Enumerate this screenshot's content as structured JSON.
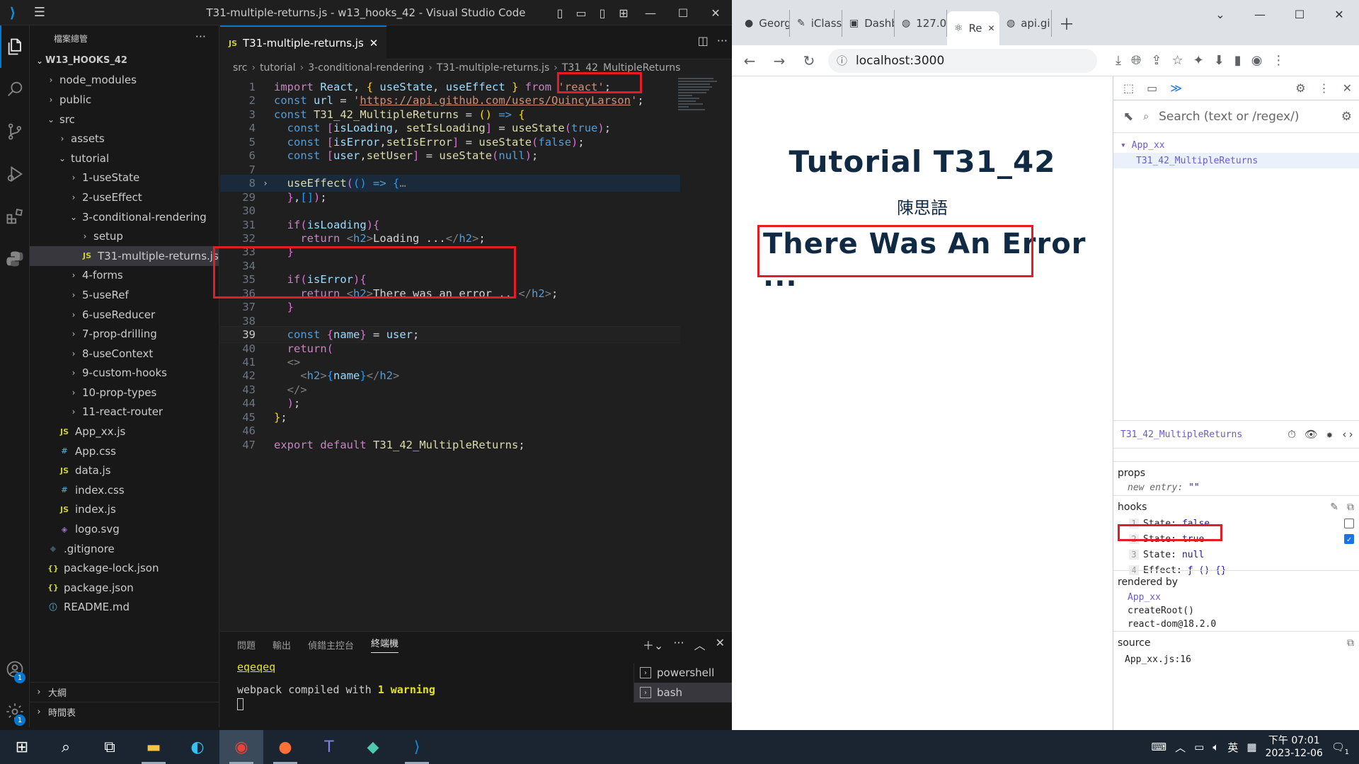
{
  "vscode": {
    "window_title": "T31-multiple-returns.js - w13_hooks_42 - Visual Studio Code",
    "explorer_header": "檔案總管",
    "root": "W13_HOOKS_42",
    "tree": [
      {
        "label": "node_modules",
        "depth": 1,
        "type": "folder",
        "open": false
      },
      {
        "label": "public",
        "depth": 1,
        "type": "folder",
        "open": false
      },
      {
        "label": "src",
        "depth": 1,
        "type": "folder",
        "open": true
      },
      {
        "label": "assets",
        "depth": 2,
        "type": "folder",
        "open": false
      },
      {
        "label": "tutorial",
        "depth": 2,
        "type": "folder",
        "open": true
      },
      {
        "label": "1-useState",
        "depth": 3,
        "type": "folder",
        "open": false
      },
      {
        "label": "2-useEffect",
        "depth": 3,
        "type": "folder",
        "open": false
      },
      {
        "label": "3-conditional-rendering",
        "depth": 3,
        "type": "folder",
        "open": true
      },
      {
        "label": "setup",
        "depth": 4,
        "type": "folder",
        "open": false
      },
      {
        "label": "T31-multiple-returns.js",
        "depth": 4,
        "type": "js",
        "selected": true
      },
      {
        "label": "4-forms",
        "depth": 3,
        "type": "folder",
        "open": false
      },
      {
        "label": "5-useRef",
        "depth": 3,
        "type": "folder",
        "open": false
      },
      {
        "label": "6-useReducer",
        "depth": 3,
        "type": "folder",
        "open": false
      },
      {
        "label": "7-prop-drilling",
        "depth": 3,
        "type": "folder",
        "open": false
      },
      {
        "label": "8-useContext",
        "depth": 3,
        "type": "folder",
        "open": false
      },
      {
        "label": "9-custom-hooks",
        "depth": 3,
        "type": "folder",
        "open": false
      },
      {
        "label": "10-prop-types",
        "depth": 3,
        "type": "folder",
        "open": false
      },
      {
        "label": "11-react-router",
        "depth": 3,
        "type": "folder",
        "open": false
      },
      {
        "label": "App_xx.js",
        "depth": 2,
        "type": "js"
      },
      {
        "label": "App.css",
        "depth": 2,
        "type": "css"
      },
      {
        "label": "data.js",
        "depth": 2,
        "type": "js"
      },
      {
        "label": "index.css",
        "depth": 2,
        "type": "css"
      },
      {
        "label": "index.js",
        "depth": 2,
        "type": "js"
      },
      {
        "label": "logo.svg",
        "depth": 2,
        "type": "svg"
      },
      {
        "label": ".gitignore",
        "depth": 1,
        "type": "git"
      },
      {
        "label": "package-lock.json",
        "depth": 1,
        "type": "json"
      },
      {
        "label": "package.json",
        "depth": 1,
        "type": "json"
      },
      {
        "label": "README.md",
        "depth": 1,
        "type": "info"
      }
    ],
    "outline_label": "大綱",
    "timeline_label": "時間表",
    "tab_label": "T31-multiple-returns.js",
    "tab_icon": "JS",
    "breadcrumb": [
      "src",
      "tutorial",
      "3-conditional-rendering",
      "T31-multiple-returns.js",
      "T31_42_MultipleReturns"
    ],
    "code_lines": [
      {
        "n": "1",
        "html": "<span class=\"kc\">import</span> <span class=\"v\">React</span>, <span class=\"b1\">{</span> <span class=\"v\">useState</span>, <span class=\"v\">useEffect</span> <span class=\"b1\">}</span> <span class=\"kc\">from</span> <span class=\"s\">'react'</span>;"
      },
      {
        "n": "2",
        "html": "<span class=\"k\">const</span> <span class=\"v\">url</span> = <span class=\"s\">'<u>https://api.github.com/users/QuincyLarson</u>'</span>;"
      },
      {
        "n": "3",
        "html": "<span class=\"k\">const</span> <span class=\"f\">T31_42_MultipleReturns</span> = <span class=\"b1\">()</span> <span class=\"k\">=></span> <span class=\"b1\">{</span>"
      },
      {
        "n": "4",
        "html": "  <span class=\"k\">const</span> <span class=\"b2\">[</span><span class=\"v\">isLoading</span>, <span class=\"f\">setIsLoading</span><span class=\"b2\">]</span> = <span class=\"f\">useState</span><span class=\"b2\">(</span><span class=\"k\">true</span><span class=\"b2\">)</span>;"
      },
      {
        "n": "5",
        "html": "  <span class=\"k\">const</span> <span class=\"b2\">[</span><span class=\"v\">isError</span>,<span class=\"f\">setIsError</span><span class=\"b2\">]</span> = <span class=\"f\">useState</span><span class=\"b2\">(</span><span class=\"k\">false</span><span class=\"b2\">)</span>;"
      },
      {
        "n": "6",
        "html": "  <span class=\"k\">const</span> <span class=\"b2\">[</span><span class=\"v\">user</span>,<span class=\"f\">setUser</span><span class=\"b2\">]</span> = <span class=\"f\">useState</span><span class=\"b2\">(</span><span class=\"k\">null</span><span class=\"b2\">)</span>;"
      },
      {
        "n": "7",
        "html": ""
      },
      {
        "n": "8",
        "html": "  <span class=\"f\">useEffect</span><span class=\"b2\">(</span><span class=\"b3\">()</span> <span class=\"k\">=></span> <span class=\"b3\">{</span><span class=\"g\">…</span>",
        "fold": "›",
        "hl": true
      },
      {
        "n": "29",
        "html": "  <span class=\"b2\">}</span>,<span class=\"b3\">[]</span><span class=\"b2\">)</span>;"
      },
      {
        "n": "30",
        "html": ""
      },
      {
        "n": "31",
        "html": "  <span class=\"kc\">if</span><span class=\"b2\">(</span><span class=\"v\">isLoading</span><span class=\"b2\">){</span>"
      },
      {
        "n": "32",
        "html": "    <span class=\"kc\">return</span> <span class=\"g\">&lt;</span><span class=\"tg\">h2</span><span class=\"g\">&gt;</span>Loading ...<span class=\"g\">&lt;/</span><span class=\"tg\">h2</span><span class=\"g\">&gt;</span>;"
      },
      {
        "n": "33",
        "html": "  <span class=\"b2\">}</span>"
      },
      {
        "n": "34",
        "html": ""
      },
      {
        "n": "35",
        "html": "  <span class=\"kc\">if</span><span class=\"b2\">(</span><span class=\"v\">isError</span><span class=\"b2\">){</span>"
      },
      {
        "n": "36",
        "html": "    <span class=\"kc\">return</span> <span class=\"g\">&lt;</span><span class=\"tg\">h2</span><span class=\"g\">&gt;</span>There was an error ...<span class=\"g\">&lt;/</span><span class=\"tg\">h2</span><span class=\"g\">&gt;</span>;"
      },
      {
        "n": "37",
        "html": "  <span class=\"b2\">}</span>"
      },
      {
        "n": "38",
        "html": ""
      },
      {
        "n": "39",
        "html": "  <span class=\"k\">const</span> <span class=\"b2\">{</span><span class=\"v\">name</span><span class=\"b2\">}</span> = <span class=\"v\">user</span>;",
        "cur": true
      },
      {
        "n": "40",
        "html": "  <span class=\"kc\">return</span><span class=\"b2\">(</span>"
      },
      {
        "n": "41",
        "html": "  <span class=\"g\">&lt;&gt;</span>"
      },
      {
        "n": "42",
        "html": "    <span class=\"g\">&lt;</span><span class=\"tg\">h2</span><span class=\"g\">&gt;</span><span class=\"b3\">{</span><span class=\"v\">name</span><span class=\"b3\">}</span><span class=\"g\">&lt;/</span><span class=\"tg\">h2</span><span class=\"g\">&gt;</span>"
      },
      {
        "n": "43",
        "html": "  <span class=\"g\">&lt;/&gt;</span>"
      },
      {
        "n": "44",
        "html": "  <span class=\"b2\">)</span>;"
      },
      {
        "n": "45",
        "html": "<span class=\"b1\">}</span>;"
      },
      {
        "n": "46",
        "html": ""
      },
      {
        "n": "47",
        "html": "<span class=\"kc\">export</span> <span class=\"kc\">default</span> <span class=\"f\">T31_42_MultipleReturns</span>;"
      }
    ],
    "panel_tabs": [
      "問題",
      "輸出",
      "偵錯主控台",
      "終端機"
    ],
    "terminal": {
      "line1": "eqeqeq",
      "line2_prefix": "webpack compiled with ",
      "line2_em": "1 warning"
    },
    "shells": [
      "powershell",
      "bash"
    ],
    "account_badge": "1",
    "settings_badge": "1"
  },
  "chrome": {
    "tabs": [
      {
        "label": "Georg",
        "icon": "github-icon"
      },
      {
        "label": "iClass",
        "icon": "iclass-icon"
      },
      {
        "label": "Dashb",
        "icon": "dashboard-icon"
      },
      {
        "label": "127.0",
        "icon": "globe-icon"
      },
      {
        "label": "Re",
        "icon": "react-icon",
        "active": true
      },
      {
        "label": "api.gi",
        "icon": "globe-icon"
      }
    ],
    "url": "localhost:3000",
    "page": {
      "title": "Tutorial T31_42",
      "subtitle": "陳思語",
      "error": "There Was An Error ..."
    },
    "devtools": {
      "search_placeholder": "Search (text or /regex/)",
      "tree": [
        {
          "label": "▾ App_xx"
        },
        {
          "label": "T31_42_MultipleReturns",
          "selected": true
        }
      ],
      "component": "T31_42_MultipleReturns",
      "props_title": "props",
      "props_new_entry_label": "new entry:",
      "props_new_entry_value": "\"\"",
      "hooks_title": "hooks",
      "hooks": [
        {
          "n": "1",
          "k": "State:",
          "v": "false"
        },
        {
          "n": "2",
          "k": "State:",
          "v": "true"
        },
        {
          "n": "3",
          "k": "State:",
          "v": "null"
        },
        {
          "n": "4",
          "k": "Effect:",
          "v": "ƒ () {}"
        }
      ],
      "rendered_by_title": "rendered by",
      "rendered_by": [
        "App_xx",
        "createRoot()",
        "react-dom@18.2.0"
      ],
      "source_title": "source",
      "source": "App_xx.js:16"
    }
  },
  "taskbar": {
    "time_prefix": "下午",
    "time": "07:01",
    "date": "2023-12-06",
    "ime": "英",
    "notif_count": "1"
  },
  "colors": {
    "accent": "#0078d4",
    "highlight_box": "#e51c24",
    "page_text": "#102a43"
  }
}
